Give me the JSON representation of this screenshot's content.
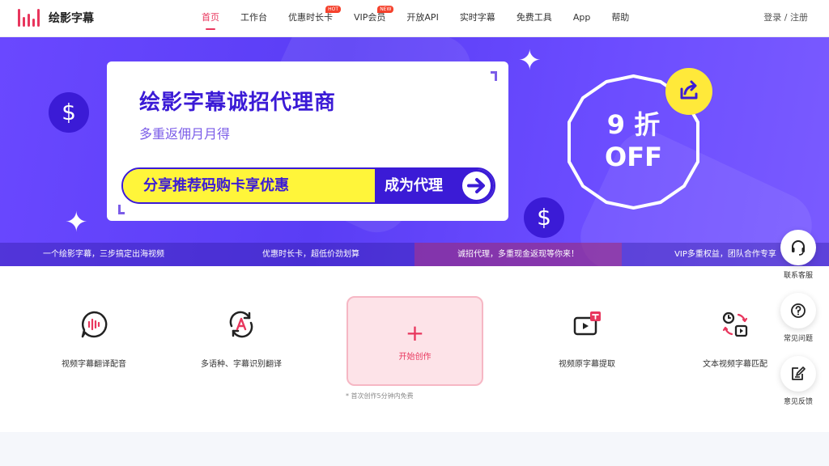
{
  "brand": {
    "name": "绘影字幕",
    "accent": "#e8365d"
  },
  "nav": {
    "items": [
      {
        "label": "首页",
        "active": true
      },
      {
        "label": "工作台"
      },
      {
        "label": "优惠时长卡",
        "badge": "HOT"
      },
      {
        "label": "VIP会员",
        "badge": "NEW"
      },
      {
        "label": "开放API"
      },
      {
        "label": "实时字幕"
      },
      {
        "label": "免费工具"
      },
      {
        "label": "App"
      },
      {
        "label": "帮助"
      }
    ],
    "login": "登录 / 注册"
  },
  "banner": {
    "title": "绘影字幕诚招代理商",
    "subtitle": "多重返佣月月得",
    "cta_left": "分享推荐码购卡享优惠",
    "cta_right": "成为代理",
    "discount_line1": "9 折",
    "discount_line2": "OFF",
    "dollar_symbol": "$",
    "ticker": [
      "一个绘影字幕，三步搞定出海视频",
      "优惠时长卡，超低价劲划算",
      "诚招代理，多重现金返现等你来！",
      "VIP多重权益，团队合作专享"
    ]
  },
  "features": {
    "items": [
      {
        "label": "视频字幕翻译配音",
        "icon": "audio-bubble-icon"
      },
      {
        "label": "多语种、字幕识别翻译",
        "icon": "translate-cycle-icon"
      },
      {
        "label": "视频原字幕提取",
        "icon": "video-text-icon"
      },
      {
        "label": "文本视频字幕匹配",
        "icon": "sync-match-icon"
      }
    ],
    "create": {
      "plus": "+",
      "label": "开始创作",
      "note": "* 首次创作5分钟内免费"
    }
  },
  "side": [
    {
      "label": "联系客服",
      "icon": "headset-icon"
    },
    {
      "label": "常见问题",
      "icon": "question-icon"
    },
    {
      "label": "意见反馈",
      "icon": "feedback-icon"
    }
  ]
}
